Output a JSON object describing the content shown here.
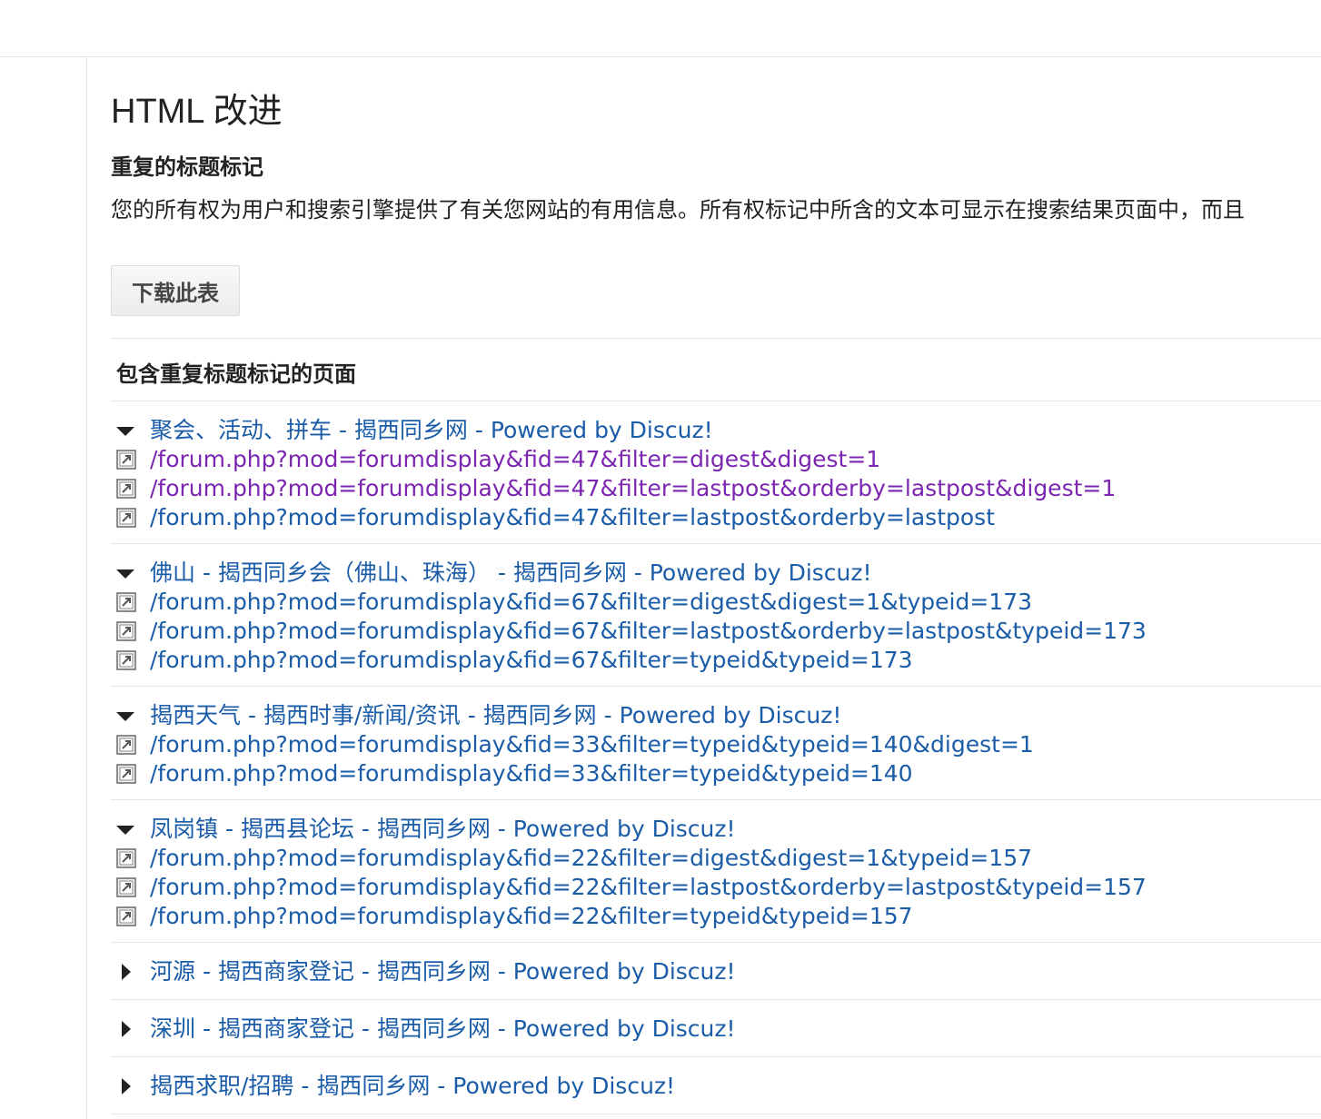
{
  "page": {
    "title": "HTML 改进",
    "section_title": "重复的标题标记",
    "description": "您的所有权为用户和搜索引擎提供了有关您网站的有用信息。所有权标记中所含的文本可显示在搜索结果页面中，而且"
  },
  "toolbar": {
    "download_label": "下载此表"
  },
  "table": {
    "header": "包含重复标题标记的页面",
    "groups": [
      {
        "title": "聚会、活动、拼车 - 揭西同乡网 - Powered by Discuz!",
        "expanded": true,
        "urls": [
          {
            "text": "/forum.php?mod=forumdisplay&fid=47&filter=digest&digest=1",
            "visited": true
          },
          {
            "text": "/forum.php?mod=forumdisplay&fid=47&filter=lastpost&orderby=lastpost&digest=1",
            "visited": true
          },
          {
            "text": "/forum.php?mod=forumdisplay&fid=47&filter=lastpost&orderby=lastpost",
            "visited": false
          }
        ]
      },
      {
        "title": "佛山 - 揭西同乡会（佛山、珠海） - 揭西同乡网 - Powered by Discuz!",
        "expanded": true,
        "urls": [
          {
            "text": "/forum.php?mod=forumdisplay&fid=67&filter=digest&digest=1&typeid=173",
            "visited": false
          },
          {
            "text": "/forum.php?mod=forumdisplay&fid=67&filter=lastpost&orderby=lastpost&typeid=173",
            "visited": false
          },
          {
            "text": "/forum.php?mod=forumdisplay&fid=67&filter=typeid&typeid=173",
            "visited": false
          }
        ]
      },
      {
        "title": "揭西天气 - 揭西时事/新闻/资讯 - 揭西同乡网 - Powered by Discuz!",
        "expanded": true,
        "urls": [
          {
            "text": "/forum.php?mod=forumdisplay&fid=33&filter=typeid&typeid=140&digest=1",
            "visited": false
          },
          {
            "text": "/forum.php?mod=forumdisplay&fid=33&filter=typeid&typeid=140",
            "visited": false
          }
        ]
      },
      {
        "title": "凤岗镇 - 揭西县论坛 - 揭西同乡网 - Powered by Discuz!",
        "expanded": true,
        "urls": [
          {
            "text": "/forum.php?mod=forumdisplay&fid=22&filter=digest&digest=1&typeid=157",
            "visited": false
          },
          {
            "text": "/forum.php?mod=forumdisplay&fid=22&filter=lastpost&orderby=lastpost&typeid=157",
            "visited": false
          },
          {
            "text": "/forum.php?mod=forumdisplay&fid=22&filter=typeid&typeid=157",
            "visited": false
          }
        ]
      },
      {
        "title": "河源 - 揭西商家登记 - 揭西同乡网 - Powered by Discuz!",
        "expanded": false,
        "urls": []
      },
      {
        "title": "深圳 - 揭西商家登记 - 揭西同乡网 - Powered by Discuz!",
        "expanded": false,
        "urls": []
      },
      {
        "title": "揭西求职/招聘 - 揭西同乡网 - Powered by Discuz!",
        "expanded": false,
        "urls": []
      }
    ]
  },
  "icons": {
    "expanded": "triangle-down-icon",
    "collapsed": "triangle-right-icon",
    "open_link": "external-link-icon"
  },
  "colors": {
    "link": "#1a5ca8",
    "visited_link": "#7b25b0",
    "divider": "#e5e5e5",
    "text": "#222222"
  }
}
